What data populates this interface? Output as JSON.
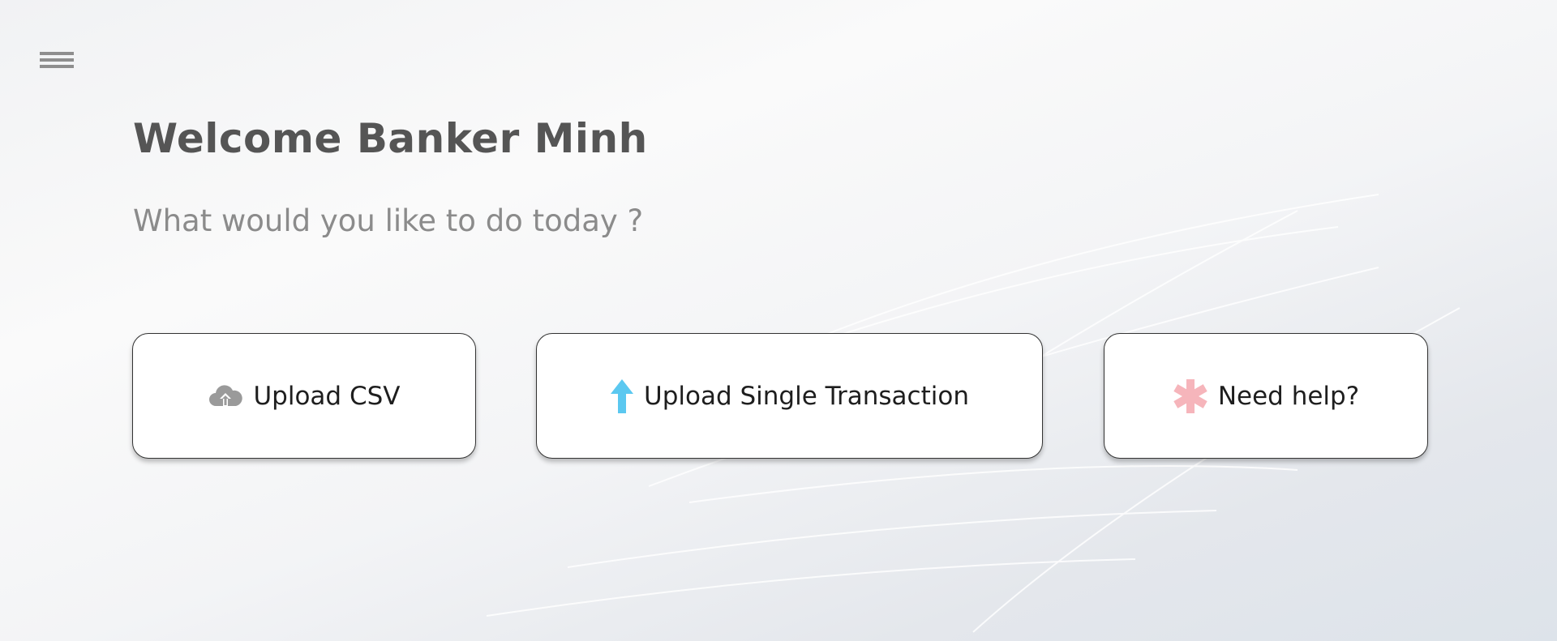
{
  "header": {
    "menu_icon": "hamburger-icon",
    "title": "Welcome Banker Minh",
    "subtitle": "What would you like to do today ?"
  },
  "actions": [
    {
      "label": "Upload CSV",
      "icon": "cloud-upload-icon",
      "icon_color": "#9a9a9a"
    },
    {
      "label": "Upload Single Transaction",
      "icon": "arrow-up-icon",
      "icon_color": "#5bc8f0"
    },
    {
      "label": "Need help?",
      "icon": "asterisk-icon",
      "icon_color": "#f6b5bb"
    }
  ]
}
